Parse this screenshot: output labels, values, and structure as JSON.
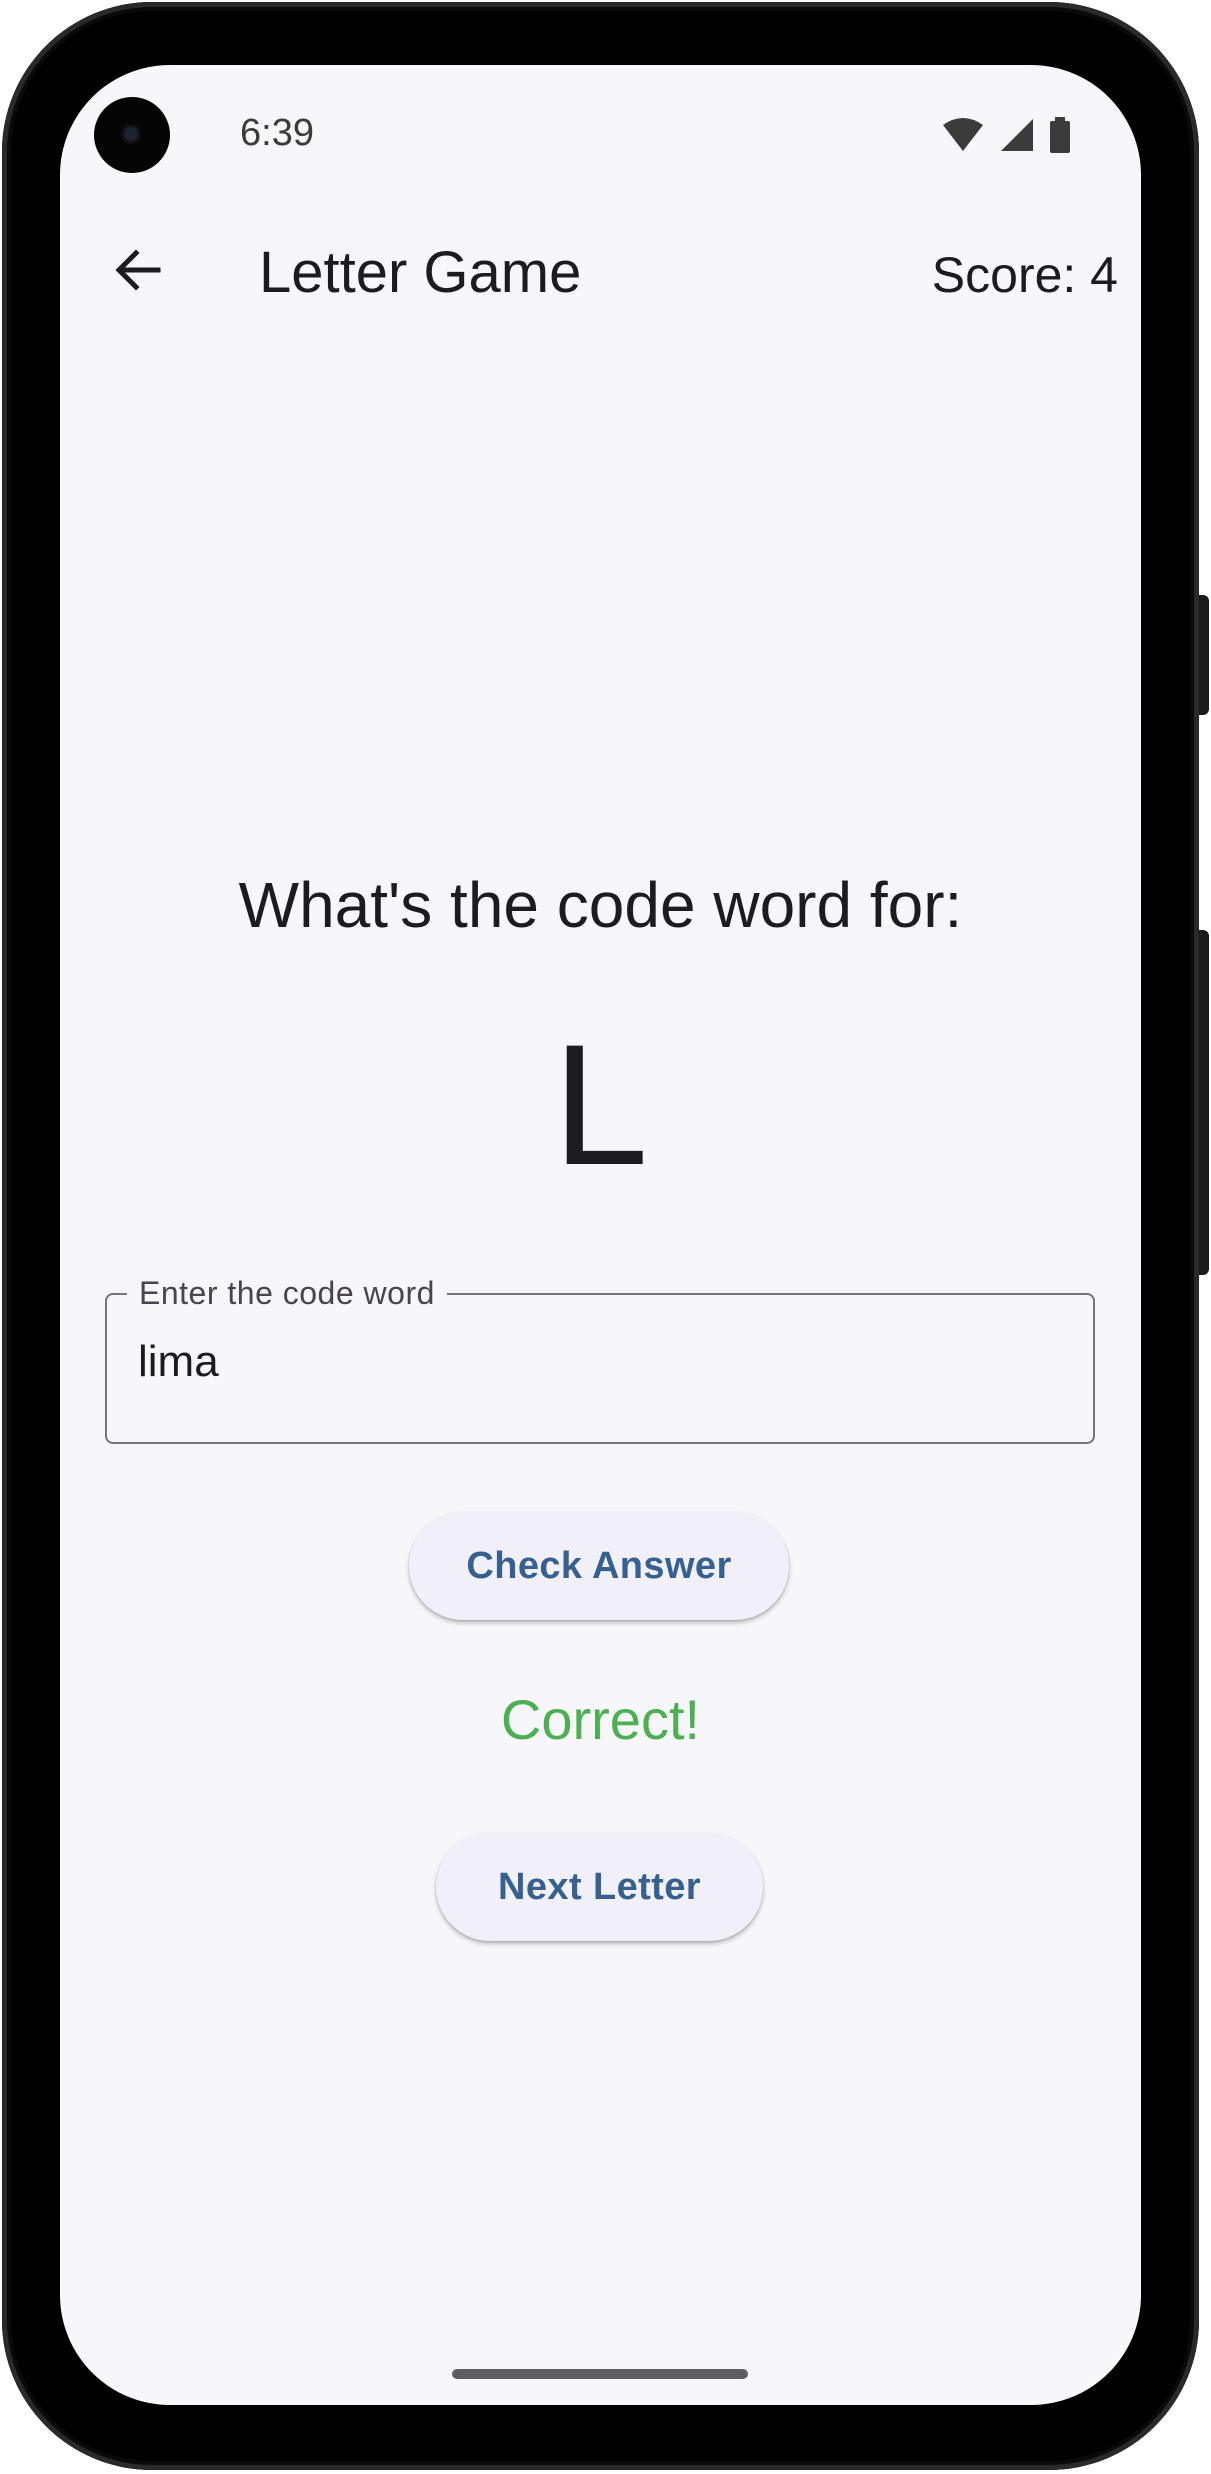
{
  "status_bar": {
    "time": "6:39",
    "icons": [
      "wifi-icon",
      "cellular-signal-icon",
      "battery-icon"
    ]
  },
  "app_bar": {
    "back_icon": "arrow-back-icon",
    "title": "Letter Game",
    "score": "Score: 4"
  },
  "quiz": {
    "prompt": "What's the code word for:",
    "letter": "L",
    "input_label": "Enter the code word",
    "input_value": "lima",
    "check_button": "Check Answer",
    "feedback": "Correct!",
    "next_button": "Next Letter"
  },
  "colors": {
    "background": "#f6f6fb",
    "button_text": "#35608f",
    "button_bg": "#f1f0f8",
    "correct": "#4caf50"
  }
}
